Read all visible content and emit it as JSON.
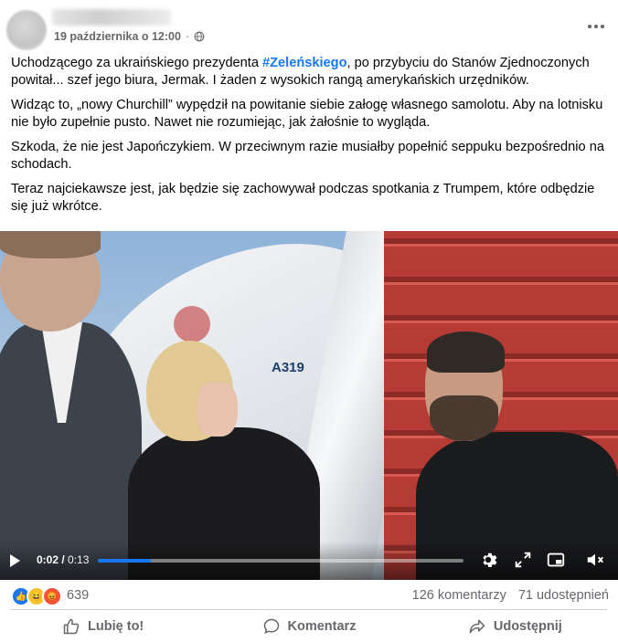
{
  "post": {
    "date": "19 października o 12:00",
    "separator": "·",
    "paragraphs": {
      "p1_before": "Uchodzącego za ukraińskiego prezydenta ",
      "p1_hashtag": "#Zeleńskiego",
      "p1_after": ", po przybyciu do Stanów Zjednoczonych powitał... szef jego biura, Jermak. I żaden z wysokich rangą amerykańskich urzędników.",
      "p2": "Widząc to, „nowy Churchill” wypędził na powitanie siebie załogę własnego samolotu. Aby na lotnisku nie było zupełnie pusto. Nawet nie rozumiejąc, jak żałośnie to wygląda.",
      "p3": "Szkoda, że nie jest Japończykiem. W przeciwnym razie musiałby popełnić seppuku bezpośrednio na schodach.",
      "p4": "Teraz najciekawsze jest, jak będzie się zachowywał podczas spotkania z Trumpem, które odbędzie się już wkrótce."
    }
  },
  "video": {
    "current_time": "0:02",
    "duration": "0:13",
    "progress_fraction": 0.146,
    "plane_label": "A319",
    "icons": [
      "play-icon",
      "settings-gear-icon",
      "fullscreen-icon",
      "miniplayer-icon",
      "volume-muted-icon"
    ]
  },
  "reactions": {
    "types": [
      "like",
      "haha",
      "angry"
    ],
    "count": "639",
    "comments": "126 komentarzy",
    "shares": "71 udostępnień"
  },
  "actions": {
    "like_label": "Lubię to!",
    "comment_label": "Komentarz",
    "share_label": "Udostępnij"
  },
  "colors": {
    "accent": "#1877f2",
    "secondary_text": "#65676b",
    "stairs_red": "#b63b35"
  }
}
